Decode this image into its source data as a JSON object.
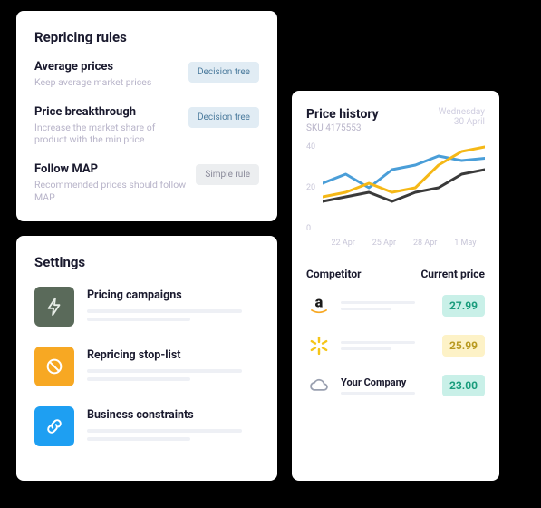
{
  "repricing": {
    "title": "Repricing rules",
    "rules": [
      {
        "title": "Average prices",
        "desc": "Keep average market prices",
        "badge": "Decision tree",
        "badge_type": "decision"
      },
      {
        "title": "Price breakthrough",
        "desc": "Increase the market share of product with the min price",
        "badge": "Decision tree",
        "badge_type": "decision"
      },
      {
        "title": "Follow MAP",
        "desc": "Recommended prices should follow MAP",
        "badge": "Simple rule",
        "badge_type": "simple"
      }
    ]
  },
  "settings": {
    "title": "Settings",
    "items": [
      {
        "title": "Pricing campaigns",
        "icon": "bolt",
        "bg": "#5a6a5a",
        "fg": "#e8eee8"
      },
      {
        "title": "Repricing stop-list",
        "icon": "ban",
        "bg": "#f7a823",
        "fg": "#ffffff"
      },
      {
        "title": "Business constraints",
        "icon": "link",
        "bg": "#1e9ff2",
        "fg": "#ffffff"
      }
    ]
  },
  "history": {
    "title": "Price history",
    "sku_label": "SKU",
    "sku_value": "4175553",
    "date_weekday": "Wednesday",
    "date_day": "30 April",
    "competitor_header": "Competitor",
    "price_header": "Current price",
    "competitors": [
      {
        "name": "",
        "icon": "amazon",
        "price": "27.99",
        "tone": "teal",
        "show_name": false
      },
      {
        "name": "",
        "icon": "walmart",
        "price": "25.99",
        "tone": "yellow",
        "show_name": false
      },
      {
        "name": "Your Company",
        "icon": "cloud",
        "price": "23.00",
        "tone": "teal",
        "show_name": true
      }
    ]
  },
  "chart_data": {
    "type": "line",
    "x": [
      "22 Apr",
      "25 Apr",
      "28 Apr",
      "1 May"
    ],
    "ylim": [
      0,
      40
    ],
    "y_ticks": [
      40,
      20,
      0
    ],
    "xlabel": "",
    "ylabel": "",
    "title": "",
    "series": [
      {
        "name": "blue",
        "color": "#4a9ed8",
        "values": [
          22,
          26,
          20,
          28,
          30,
          34,
          32,
          33
        ]
      },
      {
        "name": "yellow",
        "color": "#f5b817",
        "values": [
          16,
          18,
          22,
          18,
          20,
          30,
          36,
          38
        ]
      },
      {
        "name": "dark",
        "color": "#3a3a3a",
        "values": [
          14,
          16,
          18,
          14,
          18,
          20,
          26,
          28
        ]
      }
    ]
  }
}
